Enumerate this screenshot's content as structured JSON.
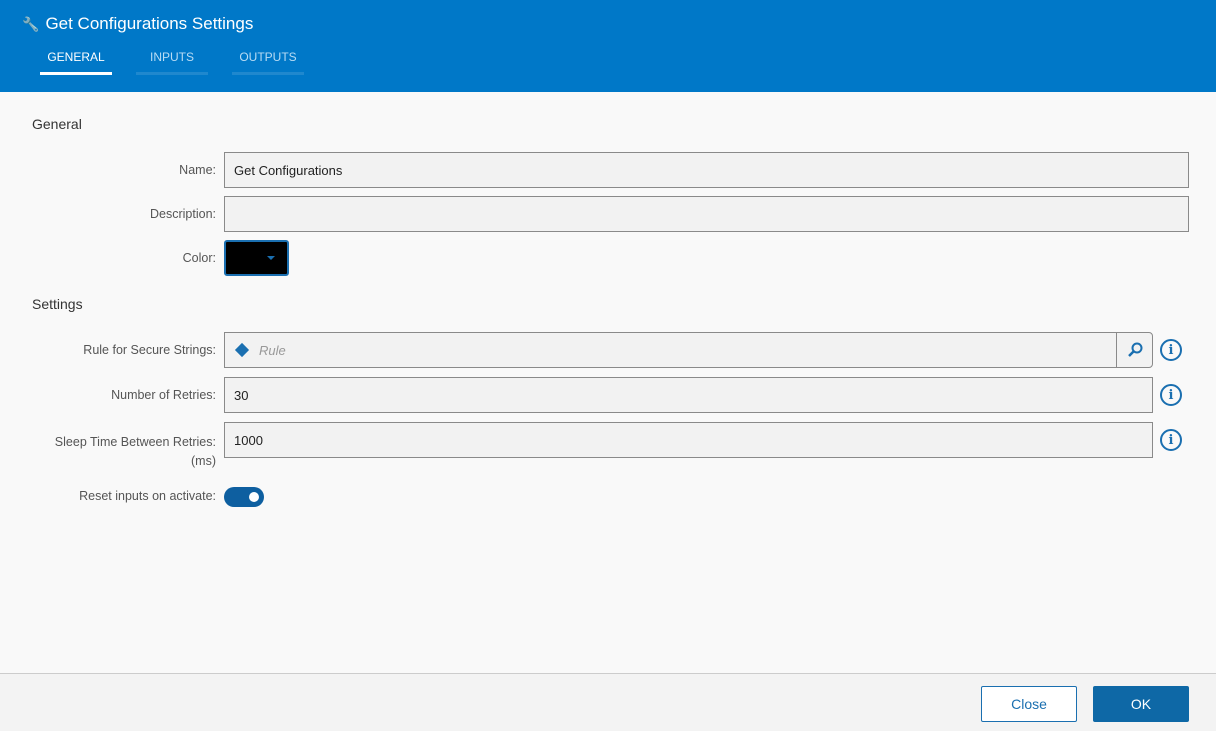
{
  "header": {
    "title": "Get Configurations Settings",
    "icon": "wrench-icon",
    "tabs": [
      {
        "label": "GENERAL",
        "active": true
      },
      {
        "label": "INPUTS"
      },
      {
        "label": "OUTPUTS"
      }
    ]
  },
  "general": {
    "heading": "General",
    "name_label": "Name:",
    "name_value": "Get Configurations",
    "description_label": "Description:",
    "description_value": "",
    "color_label": "Color:",
    "color_value": "#000000"
  },
  "settings": {
    "heading": "Settings",
    "rule_label": "Rule for Secure Strings:",
    "rule_placeholder": "Rule",
    "retries_label": "Number of Retries:",
    "retries_value": "30",
    "sleep_label": "Sleep Time Between Retries:",
    "sleep_unit": "(ms)",
    "sleep_value": "1000",
    "reset_label": "Reset inputs on activate:",
    "reset_on": true
  },
  "footer": {
    "close": "Close",
    "ok": "OK"
  }
}
